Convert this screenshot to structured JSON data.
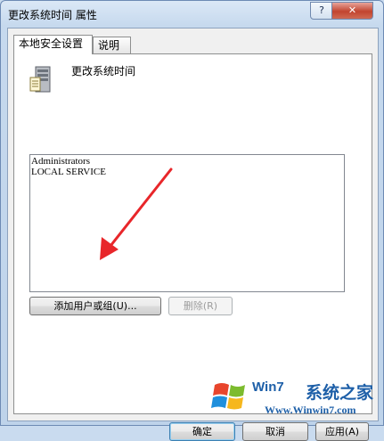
{
  "window": {
    "title": "更改系统时间 属性",
    "help_label": "?",
    "close_label": "✕"
  },
  "tabs": [
    {
      "label": "本地安全设置",
      "active": true
    },
    {
      "label": "说明",
      "active": false
    }
  ],
  "policy": {
    "name": "更改系统时间",
    "icon": "server-policy-icon"
  },
  "accounts": [
    "Administrators",
    "LOCAL SERVICE"
  ],
  "buttons": {
    "add": "添加用户或组(U)...",
    "remove": "删除(R)",
    "ok": "确定",
    "cancel": "取消",
    "apply": "应用(A)"
  },
  "watermark": {
    "brand": "Win7",
    "cn": "系统之家",
    "url": "Www.Winwin7.com"
  },
  "colors": {
    "arrow": "#e8262a",
    "accent": "#1d5fa8"
  }
}
